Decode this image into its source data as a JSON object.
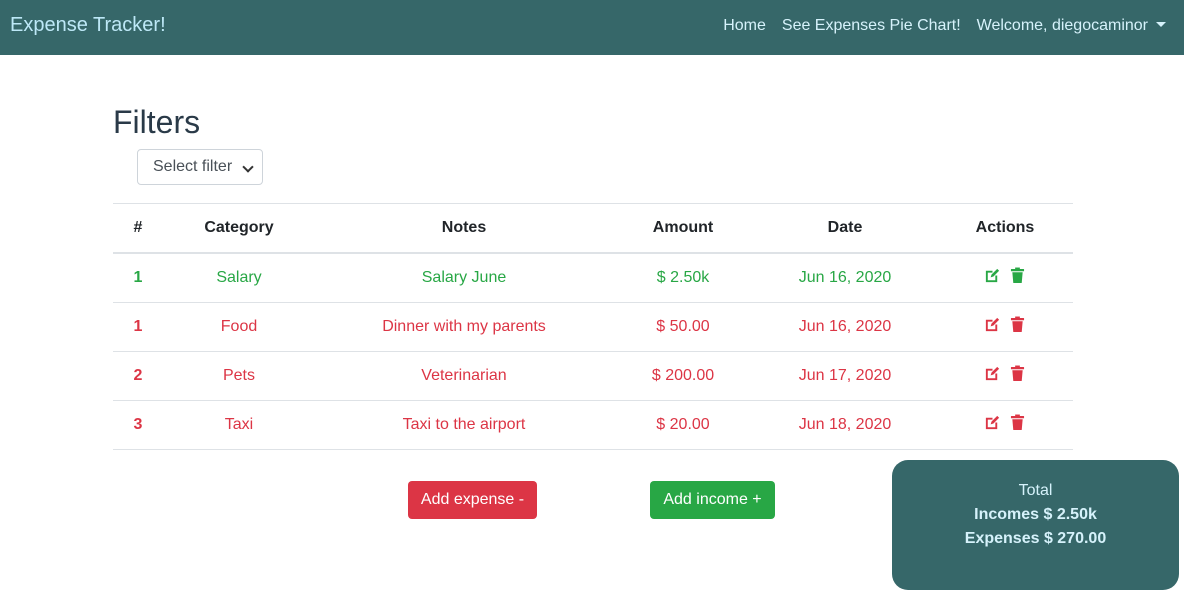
{
  "navbar": {
    "brand": "Expense Tracker!",
    "links": [
      "Home",
      "See Expenses Pie Chart!"
    ],
    "user_menu": "Welcome, diegocaminor"
  },
  "filters": {
    "title": "Filters",
    "select_value": "Select filter"
  },
  "table": {
    "headers": [
      "#",
      "Category",
      "Notes",
      "Amount",
      "Date",
      "Actions"
    ],
    "rows": [
      {
        "type": "income",
        "num": "1",
        "category": "Salary",
        "notes": "Salary June",
        "amount": "$ 2.50k",
        "date": "Jun 16, 2020"
      },
      {
        "type": "expense",
        "num": "1",
        "category": "Food",
        "notes": "Dinner with my parents",
        "amount": "$ 50.00",
        "date": "Jun 16, 2020"
      },
      {
        "type": "expense",
        "num": "2",
        "category": "Pets",
        "notes": "Veterinarian",
        "amount": "$ 200.00",
        "date": "Jun 17, 2020"
      },
      {
        "type": "expense",
        "num": "3",
        "category": "Taxi",
        "notes": "Taxi to the airport",
        "amount": "$ 20.00",
        "date": "Jun 18, 2020"
      }
    ],
    "action_icons": [
      "edit-icon",
      "trash-icon"
    ]
  },
  "buttons": {
    "add_expense": "Add expense -",
    "add_income": "Add income +"
  },
  "summary": {
    "title": "Total",
    "incomes": "Incomes $ 2.50k",
    "expenses": "Expenses $ 270.00"
  },
  "colors": {
    "navbar": "#366769",
    "income": "#28a745",
    "expense": "#dc3545"
  }
}
